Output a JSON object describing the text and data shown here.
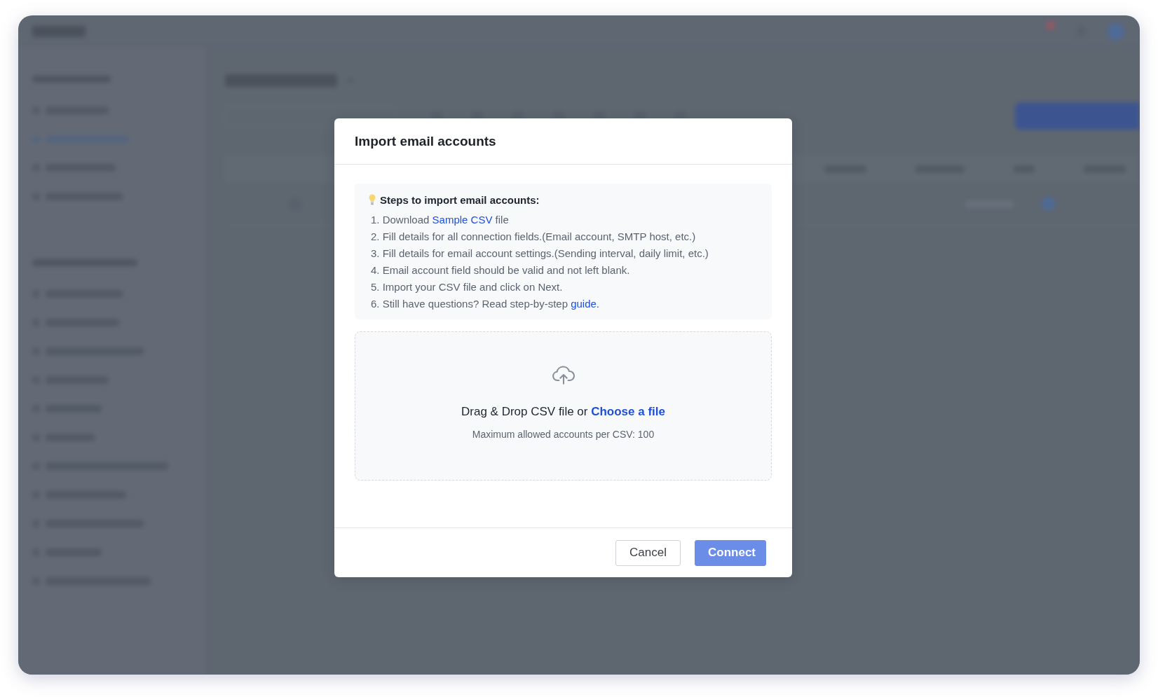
{
  "dialog": {
    "title": "Import email accounts",
    "steps": {
      "heading": "Steps to import email accounts:",
      "items": [
        {
          "text": "1. Download",
          "link": "Sample CSV",
          "after": "file"
        },
        {
          "text": "2. Fill details for all connection fields.(Email account, SMTP host, etc.)"
        },
        {
          "text": "3. Fill details for email account settings.(Sending interval, daily limit, etc.)"
        },
        {
          "text": "4. Email account field should be valid and not left blank."
        },
        {
          "text": "5. Import your CSV file and click on Next."
        },
        {
          "text": "6. Still have questions? Read step-by-step",
          "link": "guide."
        }
      ]
    },
    "upload": {
      "prompt": "Drag & Drop CSV file or",
      "link": "Choose a file",
      "note": "Maximum allowed accounts per CSV: 100"
    },
    "buttons": [
      {
        "label": "Cancel",
        "kind": "secondary",
        "disabled": false
      },
      {
        "label": "Connect",
        "kind": "primary",
        "disabled": true
      }
    ]
  }
}
